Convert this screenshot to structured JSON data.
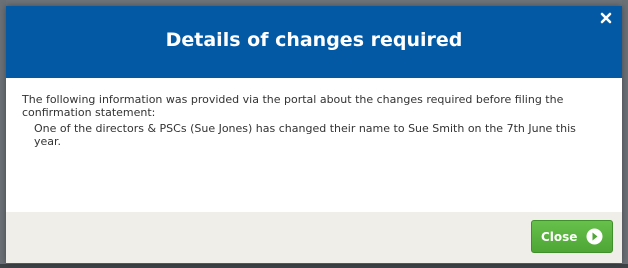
{
  "dialog": {
    "title": "Details of changes required",
    "close_icon": "close-icon",
    "intro_text": "The following information was provided via the portal about the changes required before filing the confirmation statement:",
    "detail_text": "One of the directors & PSCs (Sue Jones) has changed their name to Sue Smith on the 7th June this year.",
    "close_button_label": "Close",
    "close_button_icon": "arrow-right-circle-icon"
  },
  "colors": {
    "header_blue": "#0459a5",
    "button_green": "#5cb545",
    "footer_bg": "#f0eee8"
  }
}
